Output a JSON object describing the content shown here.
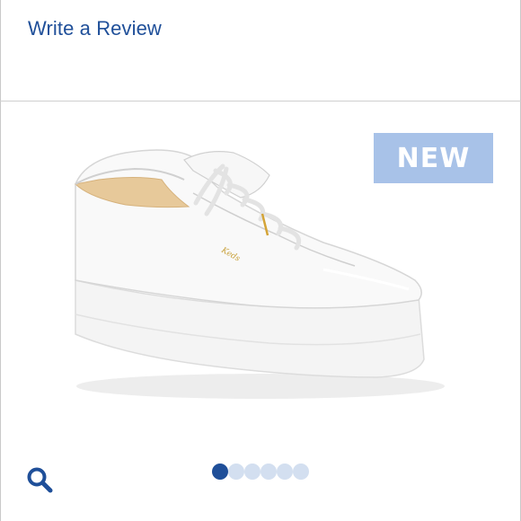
{
  "header": {
    "review_label": "Write a Review"
  },
  "product": {
    "badge": "NEW",
    "brand_mark": "Keds"
  },
  "carousel": {
    "dot_count": 6,
    "active_index": 0
  },
  "icons": {
    "zoom": "magnifier-icon"
  },
  "colors": {
    "link": "#1f4f99",
    "badge_bg": "#a8c2e8",
    "dot_active": "#1f4f99",
    "dot_inactive": "#d3dff0"
  }
}
